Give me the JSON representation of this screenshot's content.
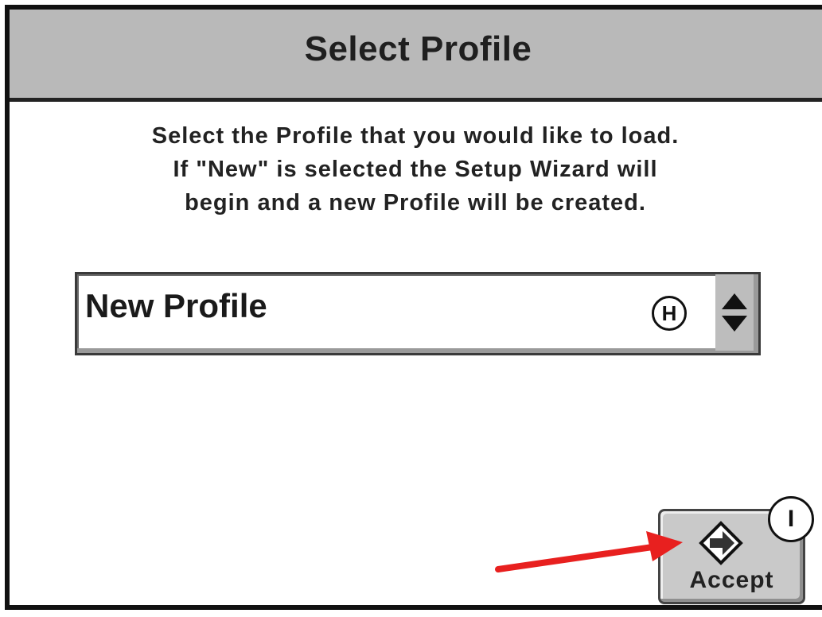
{
  "dialog": {
    "title": "Select Profile",
    "instructions": [
      "Select the Profile that you would like to load.",
      "If \"New\" is selected the Setup Wizard will",
      "begin and a new Profile will be created."
    ]
  },
  "profile_select": {
    "selected_value": "New Profile",
    "stepper_icon": "up-down-arrows-icon"
  },
  "callouts": {
    "h": "H",
    "i": "I"
  },
  "accept_button": {
    "label": "Accept",
    "icon": "arrow-in-diamond-icon"
  },
  "annotation": {
    "arrow_color": "#e8201f"
  },
  "colors": {
    "title_bar": "#b9b9b9",
    "button_face": "#c9c9c9",
    "border": "#111111"
  }
}
